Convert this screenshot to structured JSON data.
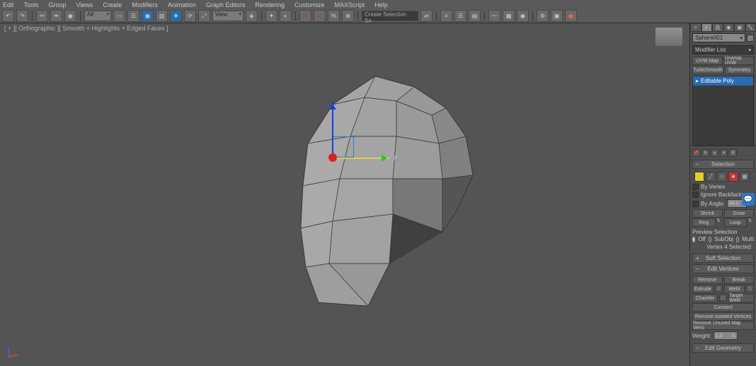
{
  "menu": [
    "Edit",
    "Tools",
    "Group",
    "Views",
    "Create",
    "Modifiers",
    "Animation",
    "Graph Editors",
    "Rendering",
    "Customize",
    "MAXScript",
    "Help"
  ],
  "toolbar": {
    "combo1": "All",
    "combo2": "View",
    "combo3": "Create Selection Se"
  },
  "viewport": {
    "label": "[ + ][ Orthographic ][ Smooth + Highlights + Edged Faces ]",
    "gizmo_y": "y"
  },
  "panel": {
    "obj_name": "Sphere001",
    "mod_list": "Modifier List",
    "btns": {
      "uvw": "UVW Map",
      "unwrap": "Unwrap UVW",
      "turbo": "TurboSmooth",
      "sym": "Symmetry"
    },
    "stack_item": "Editable Poly",
    "section_sel": "Selection",
    "byvertex": "By Vertex",
    "ignore": "Ignore Backfacing",
    "byangle": "By Angle:",
    "angle_val": "45.0",
    "shrink": "Shrink",
    "grow": "Grow",
    "ring": "Ring",
    "loop": "Loop",
    "preview": "Preview Selection",
    "off": "Off",
    "subobj": "SubObj",
    "multi": "Multi",
    "status": "Vertex 4 Selected",
    "softsel": "Soft Selection",
    "editverts": "Edit Vertices",
    "remove": "Remove",
    "break": "Break",
    "extrude": "Extrude",
    "weld": "Weld",
    "chamfer": "Chamfer",
    "target": "Target Weld",
    "connect": "Connect",
    "remiso": "Remove Isolated Vertices",
    "remmap": "Remove Unused Map Verts",
    "weight": "Weight:",
    "weight_val": "1.0",
    "editgeom": "Edit Geometry"
  }
}
